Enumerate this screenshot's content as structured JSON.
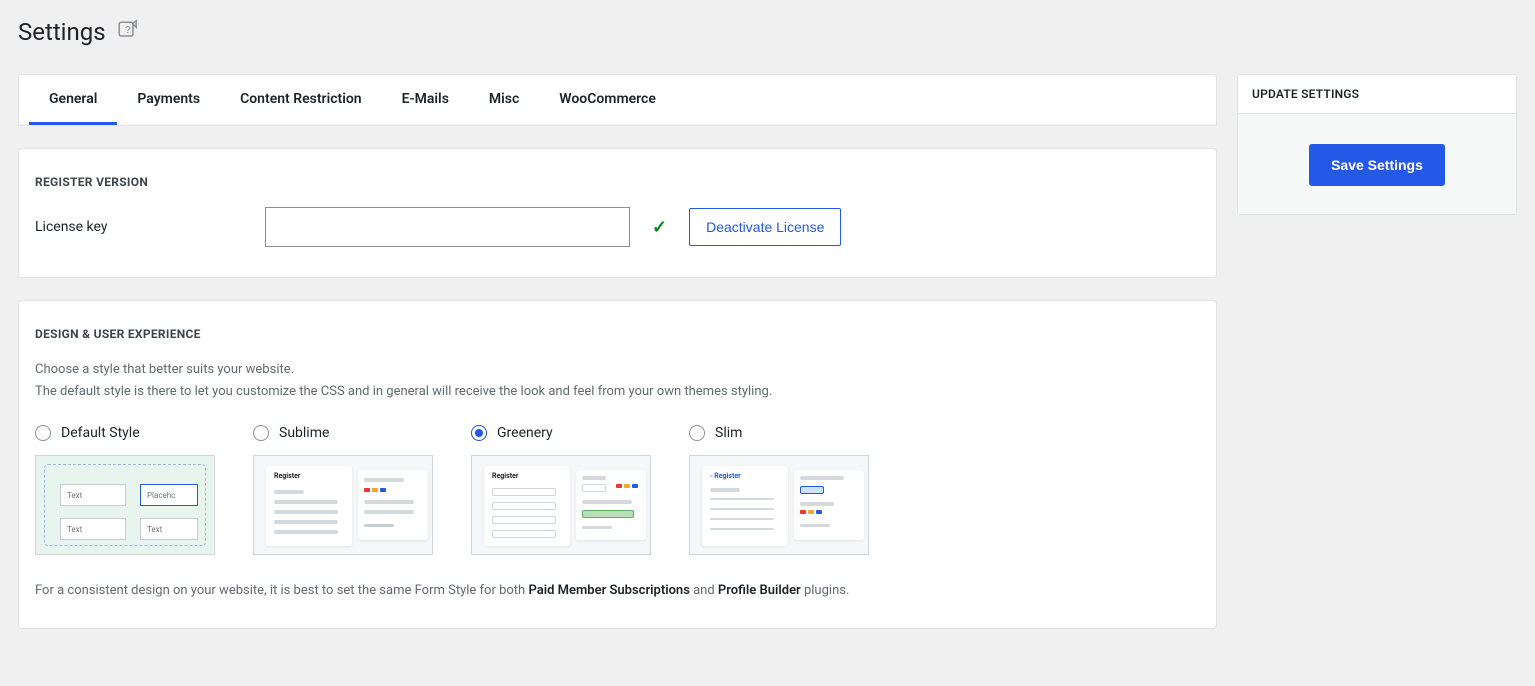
{
  "page": {
    "title": "Settings"
  },
  "tabs": {
    "items": [
      {
        "label": "General",
        "active": true
      },
      {
        "label": "Payments",
        "active": false
      },
      {
        "label": "Content Restriction",
        "active": false
      },
      {
        "label": "E-Mails",
        "active": false
      },
      {
        "label": "Misc",
        "active": false
      },
      {
        "label": "WooCommerce",
        "active": false
      }
    ]
  },
  "license": {
    "heading": "REGISTER VERSION",
    "label": "License key",
    "value": "",
    "deactivate_label": "Deactivate License"
  },
  "design": {
    "heading": "DESIGN & USER EXPERIENCE",
    "desc_line1": "Choose a style that better suits your website.",
    "desc_line2": "The default style is there to let you customize the CSS and in general will receive the look and feel from your own themes styling.",
    "options": [
      {
        "label": "Default Style",
        "selected": false
      },
      {
        "label": "Sublime",
        "selected": false
      },
      {
        "label": "Greenery",
        "selected": true
      },
      {
        "label": "Slim",
        "selected": false
      }
    ],
    "preview_labels": {
      "text": "Text",
      "placeholder": "Placehc",
      "register": "Register"
    },
    "footnote_before": "For a consistent design on your website, it is best to set the same Form Style for both ",
    "footnote_b1": "Paid Member Subscriptions",
    "footnote_mid": " and ",
    "footnote_b2": "Profile Builder",
    "footnote_after": " plugins."
  },
  "sidebar": {
    "heading": "UPDATE SETTINGS",
    "save_label": "Save Settings"
  }
}
